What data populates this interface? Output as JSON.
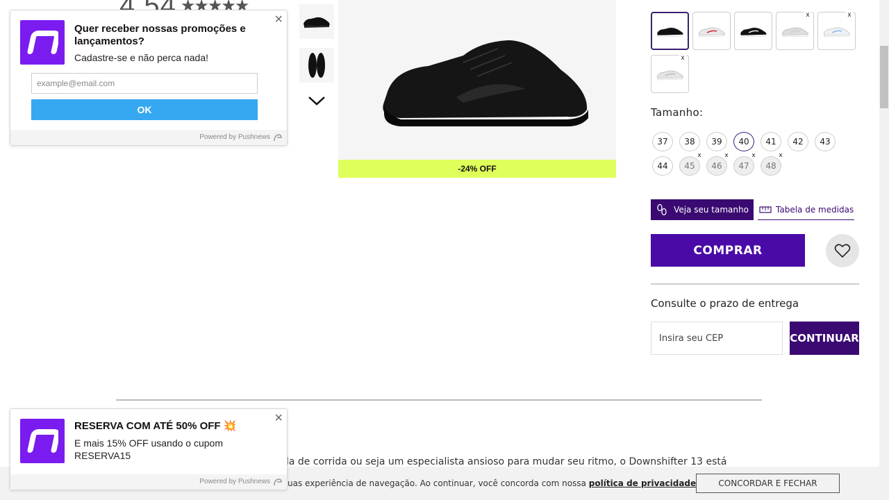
{
  "rating": {
    "value": "4,54",
    "stars": "★★★★★"
  },
  "gallery": {
    "thumbnails": [
      {
        "name": "thumb-side"
      },
      {
        "name": "thumb-soles"
      }
    ]
  },
  "product": {
    "discount_label": "-24% OFF",
    "color_options": [
      {
        "color": "black",
        "selected": true,
        "unavailable": false
      },
      {
        "color": "white-red",
        "selected": false,
        "unavailable": false
      },
      {
        "color": "black-white",
        "selected": false,
        "unavailable": false
      },
      {
        "color": "light-grey",
        "selected": false,
        "unavailable": true
      },
      {
        "color": "white-blue",
        "selected": false,
        "unavailable": true
      },
      {
        "color": "white-grey",
        "selected": false,
        "unavailable": true
      }
    ],
    "size_title": "Tamanho:",
    "sizes": [
      {
        "label": "37",
        "selected": false,
        "unavailable": false
      },
      {
        "label": "38",
        "selected": false,
        "unavailable": false
      },
      {
        "label": "39",
        "selected": false,
        "unavailable": false
      },
      {
        "label": "40",
        "selected": true,
        "unavailable": false
      },
      {
        "label": "41",
        "selected": false,
        "unavailable": false
      },
      {
        "label": "42",
        "selected": false,
        "unavailable": false
      },
      {
        "label": "43",
        "selected": false,
        "unavailable": false
      },
      {
        "label": "44",
        "selected": false,
        "unavailable": false
      },
      {
        "label": "45",
        "selected": false,
        "unavailable": true
      },
      {
        "label": "46",
        "selected": false,
        "unavailable": true
      },
      {
        "label": "47",
        "selected": false,
        "unavailable": true
      },
      {
        "label": "48",
        "selected": false,
        "unavailable": true
      }
    ],
    "unavailable_mark": "x",
    "veja_tamanho": "Veja seu tamanho",
    "tabela_medidas": "Tabela de medidas",
    "comprar": "COMPRAR",
    "delivery_title": "Consulte o prazo de entrega",
    "cep_placeholder": "Insira seu CEP",
    "continuar": "CONTINUAR",
    "description_partial": "la de corrida ou seja um especialista ansioso para mudar seu ritmo, o Downshifter 13 está"
  },
  "cookie": {
    "text": "uas experiência de navegação. Ao continuar, você concorda com nossa ",
    "link": "política de privacidade.",
    "button": "CONCORDAR E FECHAR"
  },
  "push_top": {
    "title": "Quer receber nossas promoções e lançamentos?",
    "subtitle": "Cadastre-se e não perca nada!",
    "email_placeholder": "example@email.com",
    "ok": "OK",
    "powered": "Powered by Pushnews"
  },
  "push_bottom": {
    "title": "RESERVA COM ATÉ 50% OFF 💥",
    "subtitle": "E mais 15% OFF usando o cupom RESERVA15",
    "powered": "Powered by Pushnews"
  },
  "colors": {
    "brand_purple": "#4a0aa8",
    "dark_purple": "#3a0a72",
    "discount_yellow": "#dfff5a",
    "push_blue": "#35a8f1",
    "pushnews_violet": "#7a1cf0"
  }
}
